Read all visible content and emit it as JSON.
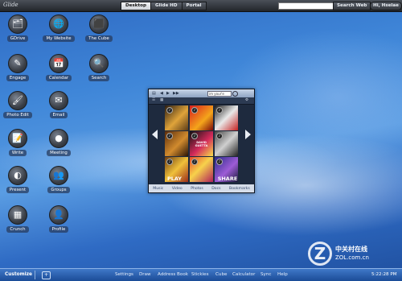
{
  "topbar": {
    "logo": "Glide",
    "tabs": [
      {
        "label": "Desktop",
        "active": true
      },
      {
        "label": "Glide HD",
        "active": false
      },
      {
        "label": "Portal",
        "active": false
      }
    ],
    "search_value": "",
    "search_button": "Search Web",
    "user_button": "Hi, Hselae"
  },
  "desktop_icons": [
    {
      "label": "GDrive",
      "icon": "drive-icon"
    },
    {
      "label": "My Website",
      "icon": "website-icon"
    },
    {
      "label": "The Cube",
      "icon": "cube-icon"
    },
    {
      "label": "Engage",
      "icon": "engage-icon"
    },
    {
      "label": "Calendar",
      "icon": "calendar-icon"
    },
    {
      "label": "Search",
      "icon": "search-icon"
    },
    {
      "label": "Photo Edit",
      "icon": "photo-edit-icon"
    },
    {
      "label": "Email",
      "icon": "email-icon"
    },
    {
      "label": "Write",
      "icon": "write-icon"
    },
    {
      "label": "Meeting",
      "icon": "meeting-icon"
    },
    {
      "label": "Present",
      "icon": "present-icon"
    },
    {
      "label": "Groups",
      "icon": "groups-icon"
    },
    {
      "label": "Crunch",
      "icon": "crunch-icon"
    },
    {
      "label": "Profile",
      "icon": "profile-icon"
    }
  ],
  "widget": {
    "search_value": "im your'e",
    "cover_labels": [
      "DAVID GUETTA"
    ],
    "play_label": "PLAY",
    "share_label": "SHARE",
    "tabs": [
      "Music",
      "Video",
      "Photos",
      "Docs",
      "Bookmarks"
    ]
  },
  "taskbar": {
    "customize": "Customize",
    "links": [
      "Settings",
      "Draw",
      "Address Book",
      "Stickies",
      "Cube",
      "Calculator",
      "Sync",
      "Help"
    ],
    "clock": "5:22:28 PM"
  },
  "watermark": {
    "letter": "Z",
    "line1": "中关村在线",
    "line2": "ZOL.com.cn"
  }
}
